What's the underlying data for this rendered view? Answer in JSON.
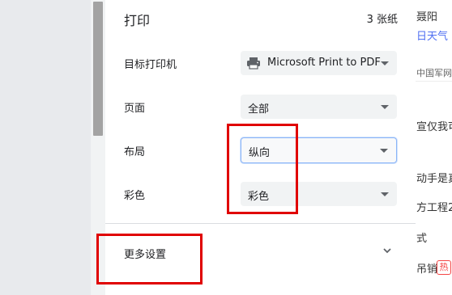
{
  "dialog": {
    "title": "打印",
    "sheet_count": "3 张纸",
    "rows": [
      {
        "label": "目标打印机",
        "value": "Microsoft Print to PDF",
        "icon": "printer-icon"
      },
      {
        "label": "页面",
        "value": "全部"
      },
      {
        "label": "布局",
        "value": "纵向"
      },
      {
        "label": "彩色",
        "value": "彩色"
      }
    ],
    "more_settings": "更多设置"
  },
  "background_page": {
    "items": [
      "聂阳",
      "日天气",
      "中国军网",
      "宣仅我可",
      "动手是真",
      "方工程2",
      "式",
      "吊销"
    ],
    "hot_badge": "热"
  },
  "colors": {
    "highlight": "#e00000",
    "focus": "#8ab4f8",
    "select_bg": "#f1f3f4"
  }
}
